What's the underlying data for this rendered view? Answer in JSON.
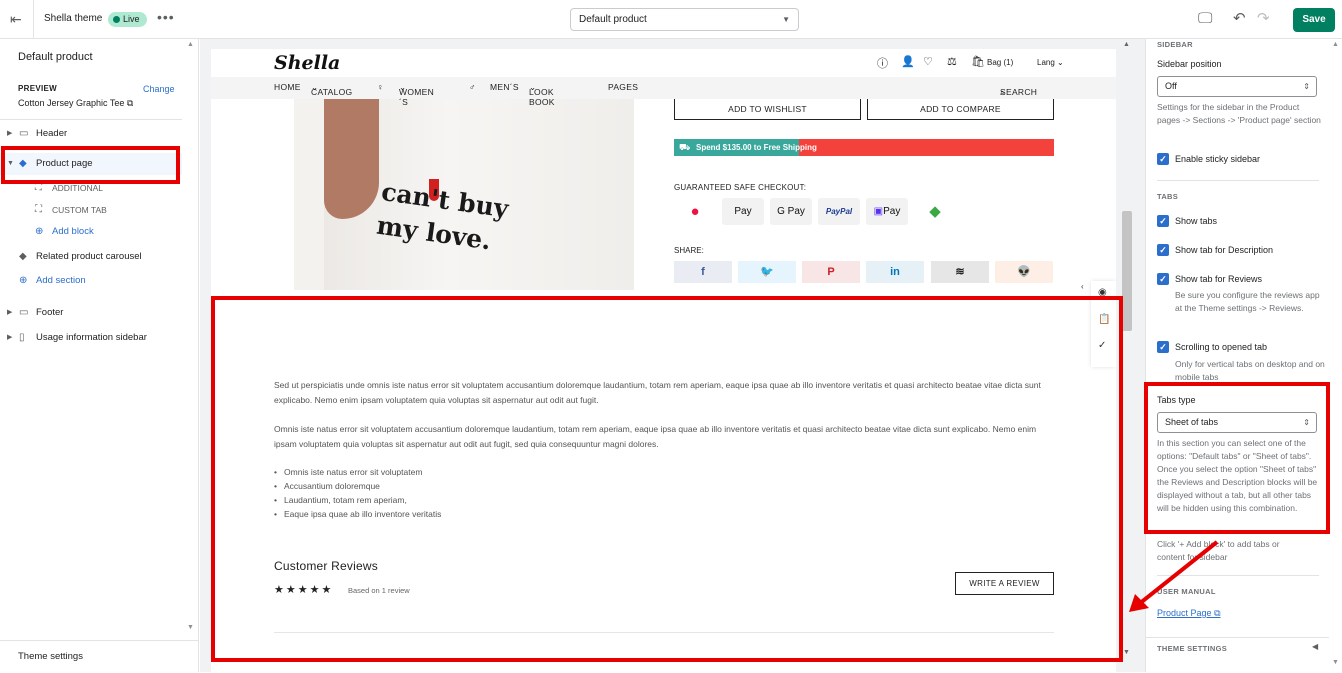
{
  "topbar": {
    "theme_name": "Shella theme",
    "live_badge": "Live",
    "template_select": "Default product",
    "save_label": "Save"
  },
  "left_sidebar": {
    "title": "Default product",
    "preview_label": "PREVIEW",
    "change_link": "Change",
    "preview_product": "Cotton Jersey Graphic Tee",
    "items": [
      {
        "label": "Header"
      },
      {
        "label": "Product page"
      },
      {
        "label": "ADDITIONAL"
      },
      {
        "label": "CUSTOM TAB"
      },
      {
        "label": "Add block"
      },
      {
        "label": "Related product carousel"
      },
      {
        "label": "Add section"
      },
      {
        "label": "Footer"
      },
      {
        "label": "Usage information sidebar"
      }
    ],
    "footer": "Theme settings"
  },
  "store": {
    "logo": "Shella",
    "bag": "Bag (1)",
    "lang": "Lang",
    "nav": [
      "HOME",
      "CATALOG",
      "WOMEN´S",
      "MEN´S",
      "LOOK BOOK",
      "PAGES"
    ],
    "search": "SEARCH",
    "shirt_text": "can't buy\nmy love.",
    "add_to_wishlist": "ADD TO WISHLIST",
    "add_to_compare": "ADD TO COMPARE",
    "shipping_text": "Spend $135.00 to Free Shipping",
    "shipping_progress": 0.33,
    "checkout_label": "GUARANTEED SAFE CHECKOUT:",
    "payments": [
      "",
      "Pay",
      "G Pay",
      "PayPal",
      "Pay",
      ""
    ],
    "share_label": "SHARE:",
    "social": [
      {
        "glyph": "f",
        "color": "#3b5998",
        "bg": "#e9ecf3"
      },
      {
        "glyph": "🐦",
        "color": "#1da1f2",
        "bg": "#e6f4fd"
      },
      {
        "glyph": "P",
        "color": "#cb2027",
        "bg": "#f8e6e7"
      },
      {
        "glyph": "in",
        "color": "#0077b5",
        "bg": "#e5f1f7"
      },
      {
        "glyph": "≋",
        "color": "#222222",
        "bg": "#e6e6e6"
      },
      {
        "glyph": "👽",
        "color": "#ff4500",
        "bg": "#fdeee6"
      }
    ],
    "para1": "Sed ut perspiciatis unde omnis iste natus error sit voluptatem accusantium doloremque laudantium, totam rem aperiam, eaque ipsa quae ab illo inventore veritatis et quasi architecto beatae vitae dicta sunt explicabo. Nemo enim ipsam voluptatem quia voluptas sit aspernatur aut odit aut fugit.",
    "para2": "Omnis iste natus error sit voluptatem accusantium doloremque laudantium, totam rem aperiam, eaque ipsa quae ab illo inventore veritatis et quasi architecto beatae vitae dicta sunt explicabo. Nemo enim ipsam voluptatem quia voluptas sit aspernatur aut odit aut fugit, sed quia consequuntur magni dolores.",
    "bullets": [
      "Omnis iste natus error sit voluptatem",
      "Accusantium doloremque",
      "Laudantium, totam rem aperiam,",
      "Eaque ipsa quae ab illo inventore veritatis"
    ],
    "reviews_title": "Customer Reviews",
    "stars": "★★★★★",
    "rating": 5,
    "based_on": "Based on 1 review",
    "write_review": "WRITE A REVIEW"
  },
  "right_sidebar": {
    "sec_sidebar": "SIDEBAR",
    "sidebar_position_label": "Sidebar position",
    "sidebar_position_value": "Off",
    "sidebar_help": "Settings for the sidebar in the Product pages -> Sections -> 'Product page' section",
    "sticky": "Enable sticky sidebar",
    "sec_tabs": "TABS",
    "show_tabs": "Show tabs",
    "show_desc": "Show tab for Description",
    "show_reviews": "Show tab for Reviews",
    "reviews_help": "Be sure you configure the reviews app at the Theme settings -> Reviews.",
    "scrolling": "Scrolling to opened tab",
    "scrolling_help": "Only for vertical tabs on desktop and on mobile tabs",
    "tabs_type_label": "Tabs type",
    "tabs_type_value": "Sheet of tabs",
    "tabs_help": "In this section you can select one of the options: \"Default tabs\" or \"Sheet of tabs\". Once you select the option \"Sheet of tabs\" the Reviews and Description blocks will be displayed without a tab, but all other tabs will be hidden using this combination.",
    "click_help": "Click '+ Add block' to add tabs or content for sidebar",
    "sec_manual": "USER MANUAL",
    "manual_link": "Product Page",
    "theme_settings": "THEME SETTINGS"
  }
}
